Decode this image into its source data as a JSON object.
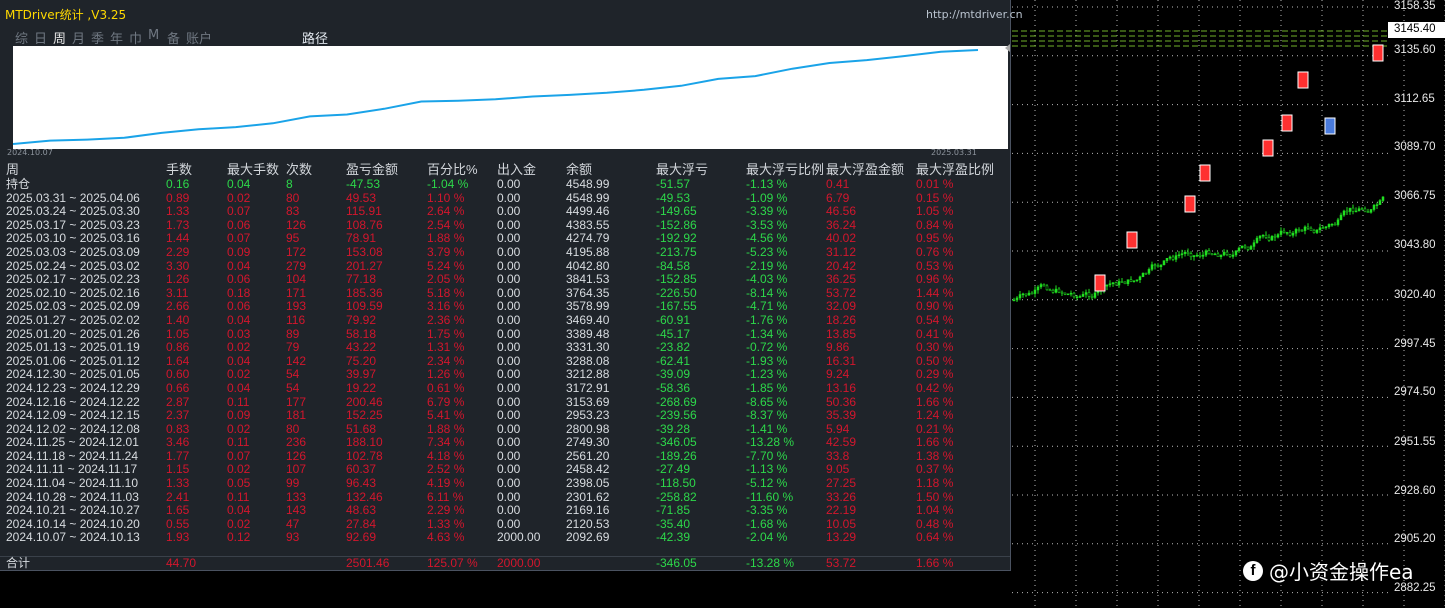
{
  "app": {
    "title": "MTDriver统计 ,V3.25",
    "url": "http://mtdriver.cn"
  },
  "tabs": [
    "综",
    "日",
    "周",
    "月",
    "季",
    "年",
    "巾",
    "M",
    "备",
    "账户"
  ],
  "active_tab_index": 2,
  "path_tab": "路径",
  "equity": {
    "start_date": "2024.10.07",
    "end_date": "2025.03.31",
    "color": "#1aa3e8"
  },
  "table": {
    "headers": [
      "周",
      "手数",
      "最大手数",
      "次数",
      "盈亏金额",
      "百分比%",
      "出入金",
      "余额",
      "最大浮亏",
      "最大浮亏比例",
      "最大浮盈金额",
      "最大浮盈比例"
    ],
    "holding": {
      "label": "持仓",
      "vals": [
        "0.16",
        "0.04",
        "8",
        "-47.53",
        "-1.04 %",
        "0.00",
        "4548.99",
        "-51.57",
        "-1.13 %",
        "0.41",
        "0.01 %"
      ]
    },
    "rows": [
      [
        "2025.03.31 ~ 2025.04.06",
        "0.89",
        "0.02",
        "80",
        "49.53",
        "1.10 %",
        "0.00",
        "4548.99",
        "-49.53",
        "-1.09 %",
        "6.79",
        "0.15 %"
      ],
      [
        "2025.03.24 ~ 2025.03.30",
        "1.33",
        "0.07",
        "83",
        "115.91",
        "2.64 %",
        "0.00",
        "4499.46",
        "-149.65",
        "-3.39 %",
        "46.56",
        "1.05 %"
      ],
      [
        "2025.03.17 ~ 2025.03.23",
        "1.73",
        "0.06",
        "126",
        "108.76",
        "2.54 %",
        "0.00",
        "4383.55",
        "-152.86",
        "-3.53 %",
        "36.24",
        "0.84 %"
      ],
      [
        "2025.03.10 ~ 2025.03.16",
        "1.44",
        "0.07",
        "95",
        "78.91",
        "1.88 %",
        "0.00",
        "4274.79",
        "-192.92",
        "-4.56 %",
        "40.02",
        "0.95 %"
      ],
      [
        "2025.03.03 ~ 2025.03.09",
        "2.29",
        "0.09",
        "172",
        "153.08",
        "3.79 %",
        "0.00",
        "4195.88",
        "-213.75",
        "-5.23 %",
        "31.12",
        "0.76 %"
      ],
      [
        "2025.02.24 ~ 2025.03.02",
        "3.30",
        "0.04",
        "279",
        "201.27",
        "5.24 %",
        "0.00",
        "4042.80",
        "-84.58",
        "-2.19 %",
        "20.42",
        "0.53 %"
      ],
      [
        "2025.02.17 ~ 2025.02.23",
        "1.26",
        "0.06",
        "104",
        "77.18",
        "2.05 %",
        "0.00",
        "3841.53",
        "-152.85",
        "-4.03 %",
        "36.25",
        "0.96 %"
      ],
      [
        "2025.02.10 ~ 2025.02.16",
        "3.11",
        "0.18",
        "171",
        "185.36",
        "5.18 %",
        "0.00",
        "3764.35",
        "-226.50",
        "-8.14 %",
        "53.72",
        "1.44 %"
      ],
      [
        "2025.02.03 ~ 2025.02.09",
        "2.66",
        "0.06",
        "193",
        "109.59",
        "3.16 %",
        "0.00",
        "3578.99",
        "-167.55",
        "-4.71 %",
        "32.09",
        "0.90 %"
      ],
      [
        "2025.01.27 ~ 2025.02.02",
        "1.40",
        "0.04",
        "116",
        "79.92",
        "2.36 %",
        "0.00",
        "3469.40",
        "-60.91",
        "-1.76 %",
        "18.26",
        "0.54 %"
      ],
      [
        "2025.01.20 ~ 2025.01.26",
        "1.05",
        "0.03",
        "89",
        "58.18",
        "1.75 %",
        "0.00",
        "3389.48",
        "-45.17",
        "-1.34 %",
        "13.85",
        "0.41 %"
      ],
      [
        "2025.01.13 ~ 2025.01.19",
        "0.86",
        "0.02",
        "79",
        "43.22",
        "1.31 %",
        "0.00",
        "3331.30",
        "-23.82",
        "-0.72 %",
        "9.86",
        "0.30 %"
      ],
      [
        "2025.01.06 ~ 2025.01.12",
        "1.64",
        "0.04",
        "142",
        "75.20",
        "2.34 %",
        "0.00",
        "3288.08",
        "-62.41",
        "-1.93 %",
        "16.31",
        "0.50 %"
      ],
      [
        "2024.12.30 ~ 2025.01.05",
        "0.60",
        "0.02",
        "54",
        "39.97",
        "1.26 %",
        "0.00",
        "3212.88",
        "-39.09",
        "-1.23 %",
        "9.24",
        "0.29 %"
      ],
      [
        "2024.12.23 ~ 2024.12.29",
        "0.66",
        "0.04",
        "54",
        "19.22",
        "0.61 %",
        "0.00",
        "3172.91",
        "-58.36",
        "-1.85 %",
        "13.16",
        "0.42 %"
      ],
      [
        "2024.12.16 ~ 2024.12.22",
        "2.87",
        "0.11",
        "177",
        "200.46",
        "6.79 %",
        "0.00",
        "3153.69",
        "-268.69",
        "-8.65 %",
        "50.36",
        "1.66 %"
      ],
      [
        "2024.12.09 ~ 2024.12.15",
        "2.37",
        "0.09",
        "181",
        "152.25",
        "5.41 %",
        "0.00",
        "2953.23",
        "-239.56",
        "-8.37 %",
        "35.39",
        "1.24 %"
      ],
      [
        "2024.12.02 ~ 2024.12.08",
        "0.83",
        "0.02",
        "80",
        "51.68",
        "1.88 %",
        "0.00",
        "2800.98",
        "-39.28",
        "-1.41 %",
        "5.94",
        "0.21 %"
      ],
      [
        "2024.11.25 ~ 2024.12.01",
        "3.46",
        "0.11",
        "236",
        "188.10",
        "7.34 %",
        "0.00",
        "2749.30",
        "-346.05",
        "-13.28 %",
        "42.59",
        "1.66 %"
      ],
      [
        "2024.11.18 ~ 2024.11.24",
        "1.77",
        "0.07",
        "126",
        "102.78",
        "4.18 %",
        "0.00",
        "2561.20",
        "-189.26",
        "-7.70 %",
        "33.8",
        "1.38 %"
      ],
      [
        "2024.11.11 ~ 2024.11.17",
        "1.15",
        "0.02",
        "107",
        "60.37",
        "2.52 %",
        "0.00",
        "2458.42",
        "-27.49",
        "-1.13 %",
        "9.05",
        "0.37 %"
      ],
      [
        "2024.11.04 ~ 2024.11.10",
        "1.33",
        "0.05",
        "99",
        "96.43",
        "4.19 %",
        "0.00",
        "2398.05",
        "-118.50",
        "-5.12 %",
        "27.25",
        "1.18 %"
      ],
      [
        "2024.10.28 ~ 2024.11.03",
        "2.41",
        "0.11",
        "133",
        "132.46",
        "6.11 %",
        "0.00",
        "2301.62",
        "-258.82",
        "-11.60 %",
        "33.26",
        "1.50 %"
      ],
      [
        "2024.10.21 ~ 2024.10.27",
        "1.65",
        "0.04",
        "143",
        "48.63",
        "2.29 %",
        "0.00",
        "2169.16",
        "-71.85",
        "-3.35 %",
        "22.19",
        "1.04 %"
      ],
      [
        "2024.10.14 ~ 2024.10.20",
        "0.55",
        "0.02",
        "47",
        "27.84",
        "1.33 %",
        "0.00",
        "2120.53",
        "-35.40",
        "-1.68 %",
        "10.05",
        "0.48 %"
      ],
      [
        "2024.10.07 ~ 2024.10.13",
        "1.93",
        "0.12",
        "93",
        "92.69",
        "4.63 %",
        "2000.00",
        "2092.69",
        "-42.39",
        "-2.04 %",
        "13.29",
        "0.64 %"
      ]
    ],
    "total": {
      "label": "合计",
      "lots": "44.70",
      "pnl": "2501.46",
      "pct": "125.07 %",
      "deposit": "2000.00",
      "max_loss": "-346.05",
      "max_loss_pct": "-13.28 %",
      "max_profit": "53.72",
      "max_profit_pct": "1.66 %"
    }
  },
  "price_axis": {
    "current": "3145.40",
    "labels": [
      "3158.35",
      "3135.60",
      "3112.65",
      "3089.70",
      "3066.75",
      "3043.80",
      "3020.40",
      "2997.45",
      "2974.50",
      "2951.55",
      "2928.60",
      "2905.20",
      "2882.25"
    ]
  },
  "watermark": "@小资金操作ea",
  "colors": {
    "profit": "#d3162d",
    "loss": "#2dd84a",
    "candle_up": "#20e020",
    "panel_bg": "#1f242a"
  }
}
